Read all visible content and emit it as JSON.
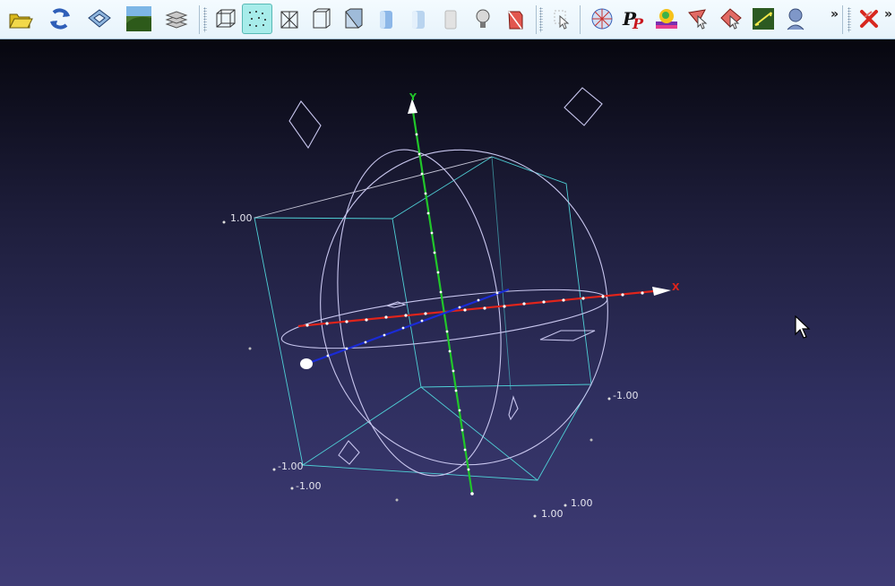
{
  "toolbar": {
    "groups": [
      [
        "open-icon",
        "reload-icon",
        "save-icon",
        "snapshot-icon",
        "layers-icon"
      ],
      [
        "bbox-icon",
        "points-icon",
        "wireframe-icon",
        "hidden-lines-icon",
        "flat-lines-icon",
        "smooth-icon",
        "flat-icon",
        "texture-icon",
        "light-icon",
        "backface-icon"
      ],
      [
        "select-icon"
      ],
      [
        "trackball-icon",
        "pp-icon",
        "colorize-icon",
        "select-faces-icon",
        "select-vertices-icon",
        "measure-icon",
        "face-icon"
      ],
      [
        "close-icon"
      ]
    ],
    "active_tool": "points-icon",
    "overflow_label": "»"
  },
  "scene": {
    "background_top": "#07070f",
    "background_bottom": "#3f3c76",
    "axis_x_label": "X",
    "axis_y_label": "Y",
    "axis_x_color": "#e0241b",
    "axis_y_color": "#21c62a",
    "axis_z_color": "#1a2bd6",
    "labels": {
      "top_left_max": "1.00",
      "right_min": "-1.00",
      "bottom_left_min_a": "-1.00",
      "bottom_left_min_b": "-1.00",
      "bottom_right_max_a": "1.00",
      "bottom_right_max_b": "1.00"
    }
  }
}
